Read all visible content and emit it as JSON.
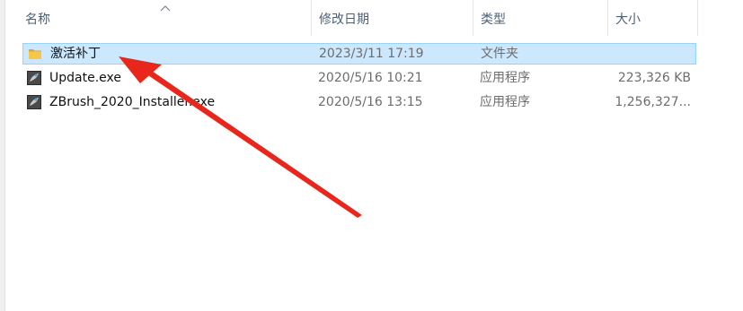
{
  "columns": {
    "name": "名称",
    "date": "修改日期",
    "type": "类型",
    "size": "大小"
  },
  "files": [
    {
      "name": "激活补丁",
      "date": "2023/3/11 17:19",
      "type": "文件夹",
      "size": "",
      "icon": "folder-icon",
      "selected": true
    },
    {
      "name": "Update.exe",
      "date": "2020/5/16 10:21",
      "type": "应用程序",
      "size": "223,326 KB",
      "icon": "zbrush-app-icon",
      "selected": false
    },
    {
      "name": "ZBrush_2020_Installer.exe",
      "date": "2020/5/16 13:15",
      "type": "应用程序",
      "size": "1,256,327...",
      "icon": "zbrush-app-icon",
      "selected": false
    }
  ],
  "colors": {
    "selection_bg": "#cce8ff",
    "selection_border": "#99d1ff",
    "annotation_arrow": "#e8261c",
    "folder": "#f8c64a"
  },
  "annotation": {
    "type": "arrow",
    "points_to": "激活补丁"
  }
}
